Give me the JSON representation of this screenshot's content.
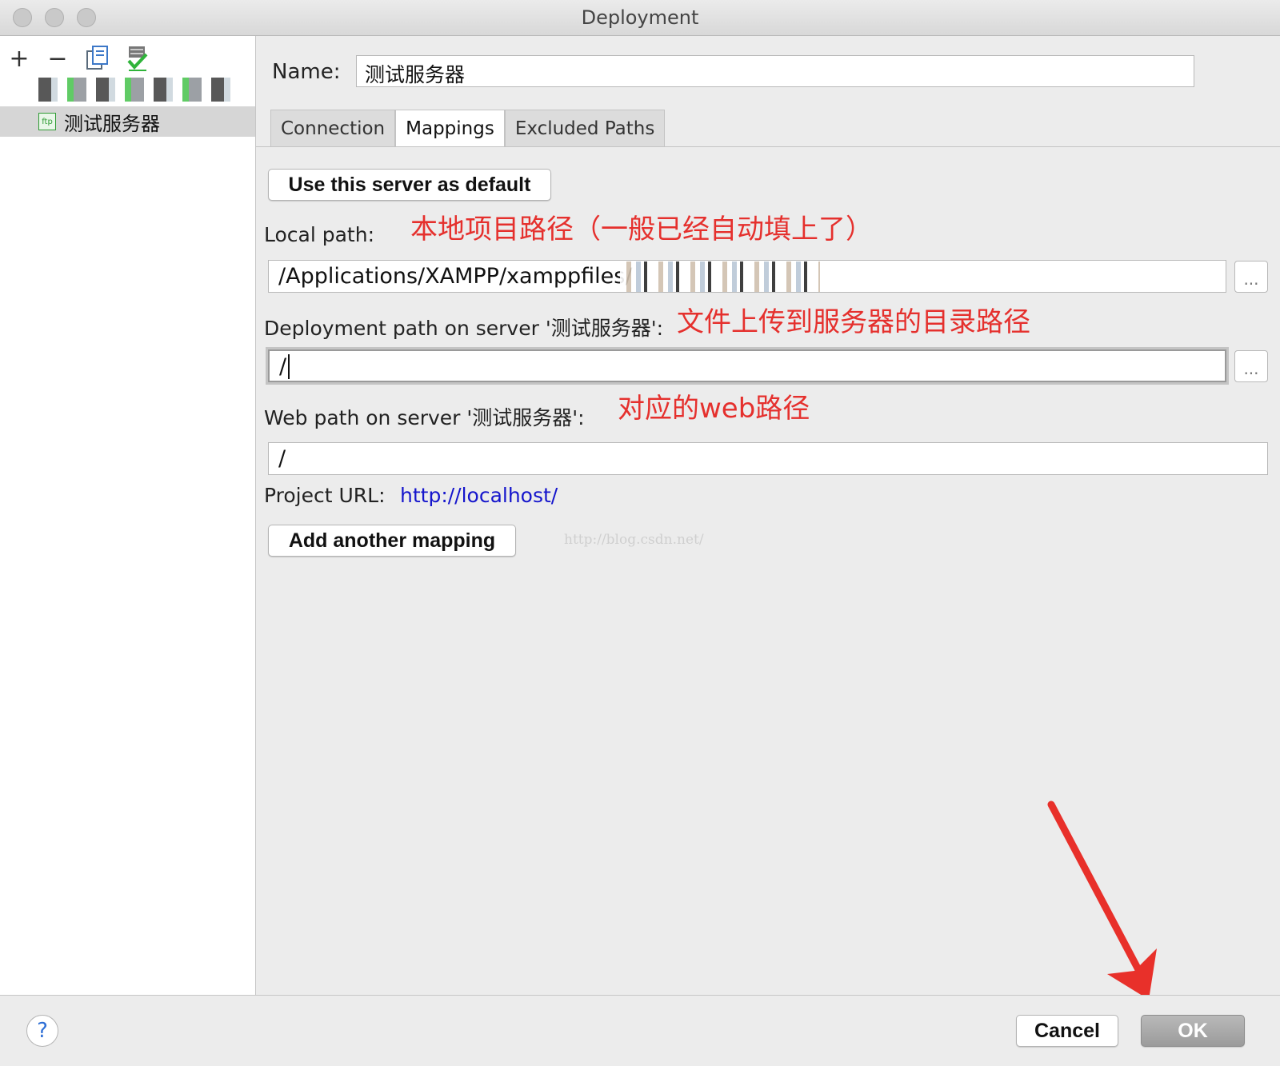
{
  "window": {
    "title": "Deployment"
  },
  "toolbar": {
    "add": "+",
    "remove": "−"
  },
  "tree": {
    "server_name": "测试服务器",
    "ftp_badge": "ftp"
  },
  "form": {
    "name_label": "Name:",
    "name_value": "测试服务器",
    "tabs": [
      "Connection",
      "Mappings",
      "Excluded Paths"
    ],
    "default_button": "Use this server as default",
    "local_path_label": "Local path:",
    "local_path_note": "本地项目路径（一般已经自动填上了）",
    "local_path_value": "/Applications/XAMPP/xamppfiles/",
    "deploy_label": "Deployment path on server '测试服务器':",
    "deploy_note": "文件上传到服务器的目录路径",
    "deploy_value": "/",
    "web_label": "Web path on server '测试服务器':",
    "web_note": "对应的web路径",
    "web_value": "/",
    "project_url_label": "Project URL:",
    "project_url": "http://localhost/",
    "add_mapping": "Add another mapping",
    "browse": "...",
    "watermark": "http://blog.csdn.net/"
  },
  "footer": {
    "help": "?",
    "cancel": "Cancel",
    "ok": "OK"
  },
  "colors": {
    "annotation": "#e5302d",
    "link": "#1515cc"
  }
}
